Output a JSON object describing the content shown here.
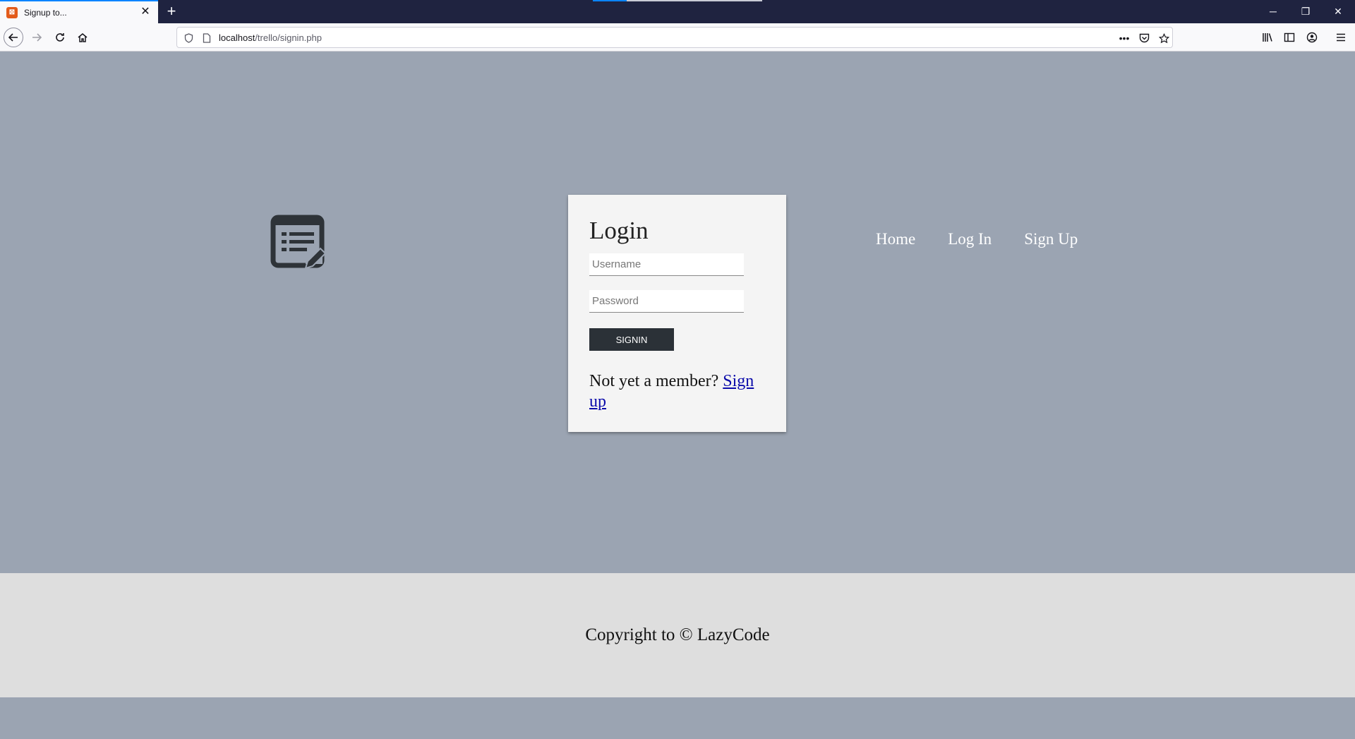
{
  "browser": {
    "tab_title": "Signup to...",
    "url_host": "localhost",
    "url_path": "/trello/signin.php"
  },
  "login": {
    "title": "Login",
    "username_placeholder": "Username",
    "password_placeholder": "Password",
    "signin_label": "SIGNIN",
    "member_prompt": "Not yet a member? ",
    "signup_link": "Sign up"
  },
  "menu": {
    "items": [
      "Home",
      "Log In",
      "Sign Up"
    ]
  },
  "footer": {
    "copyright": "Copyright to © LazyCode"
  },
  "icons": {
    "logo": "document-edit-icon"
  },
  "colors": {
    "page_bg": "#9ba4b2",
    "card_bg": "#f4f4f4",
    "button_bg": "#2b3137",
    "footer_bg": "#dedede"
  }
}
